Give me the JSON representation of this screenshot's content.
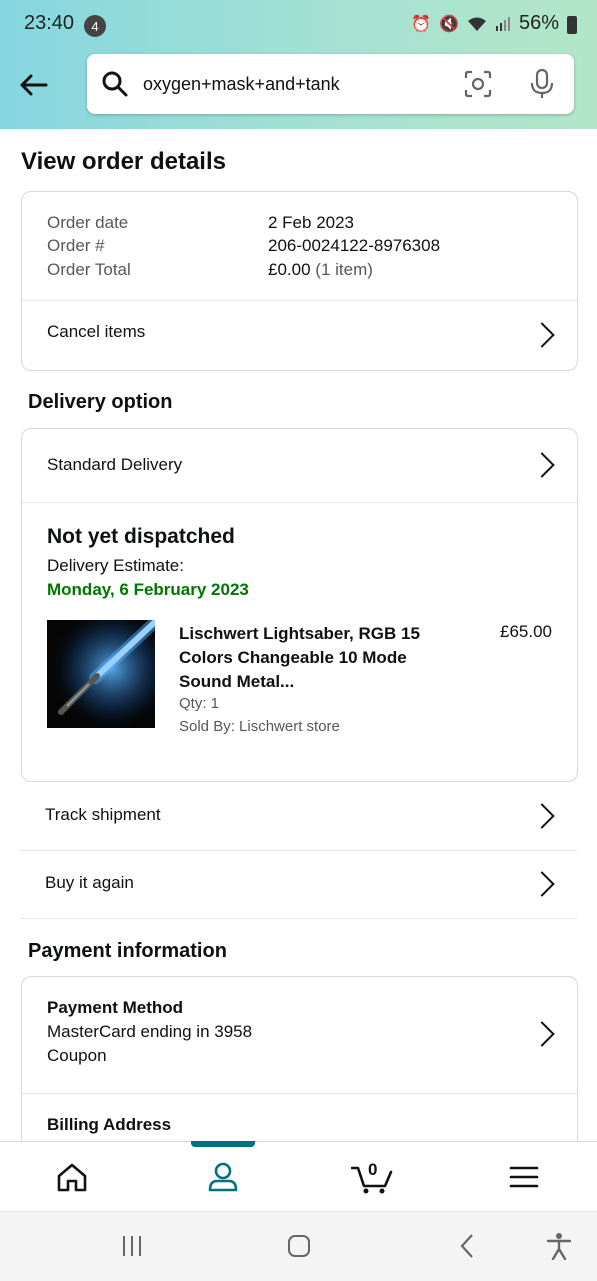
{
  "status_bar": {
    "time": "23:40",
    "notification_count": "4",
    "battery": "56%",
    "icons": [
      "alarm-icon",
      "mute-icon",
      "wifi-icon",
      "signal-icon",
      "battery-icon"
    ]
  },
  "search": {
    "query": "oxygen+mask+and+tank",
    "icons": [
      "search-icon",
      "camera-lens-icon",
      "microphone-icon"
    ]
  },
  "page_title": "View order details",
  "order_summary": {
    "date_label": "Order date",
    "date_value": "2 Feb 2023",
    "number_label": "Order #",
    "number_value": "206-0024122-8976308",
    "total_label": "Order Total",
    "total_value": "£0.00",
    "total_items": "(1 item)",
    "cancel_label": "Cancel items"
  },
  "delivery": {
    "section_title": "Delivery option",
    "option_label": "Standard Delivery",
    "status": "Not yet dispatched",
    "estimate_label": "Delivery Estimate:",
    "estimate_date": "Monday, 6 February 2023",
    "item": {
      "title": "Lischwert Lightsaber, RGB 15 Colors Changeable 10 Mode Sound Metal...",
      "price": "£65.00",
      "qty": "Qty: 1",
      "seller": "Sold By: Lischwert store"
    }
  },
  "actions": {
    "track": "Track shipment",
    "buy_again": "Buy it again"
  },
  "payment": {
    "section_title": "Payment information",
    "method_title": "Payment Method",
    "method_line1": "MasterCard ending in 3958",
    "method_line2": "Coupon",
    "billing_title": "Billing Address"
  },
  "bottom_nav": {
    "cart_count": "0",
    "items": [
      "home-icon",
      "account-icon",
      "cart-icon",
      "menu-icon"
    ],
    "active": "account"
  },
  "colors": {
    "accent": "#007185",
    "green": "#007600",
    "border": "#d5d9d9"
  }
}
